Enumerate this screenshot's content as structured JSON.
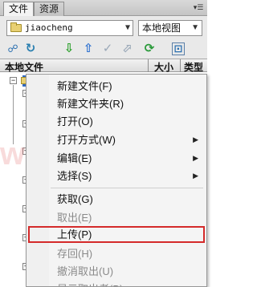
{
  "tabs": [
    {
      "label": "文件"
    },
    {
      "label": "资源"
    }
  ],
  "site_select": {
    "value": "jiaocheng"
  },
  "view_select": {
    "value": "本地视图"
  },
  "columns": {
    "name": "本地文件",
    "size": "大小",
    "type": "类型"
  },
  "context_menu": {
    "items": [
      {
        "label": "新建文件(F)",
        "enabled": true
      },
      {
        "label": "新建文件夹(R)",
        "enabled": true
      },
      {
        "label": "打开(O)",
        "enabled": true
      },
      {
        "label": "打开方式(W)",
        "enabled": true,
        "submenu": true
      },
      {
        "label": "编辑(E)",
        "enabled": true,
        "submenu": true
      },
      {
        "label": "选择(S)",
        "enabled": true,
        "submenu": true
      },
      {
        "label": "获取(G)",
        "enabled": true
      },
      {
        "label": "取出(E)",
        "enabled": false
      },
      {
        "label": "上传(P)",
        "enabled": true,
        "highlighted": true
      },
      {
        "label": "存回(H)",
        "enabled": false
      },
      {
        "label": "撤消取出(U)",
        "enabled": false
      },
      {
        "label": "显示取出者(B)",
        "enabled": false
      }
    ]
  },
  "watermark": "www.aa25.cn",
  "colors": {
    "highlight_border": "#d42a2a",
    "selection": "#316ac5"
  }
}
